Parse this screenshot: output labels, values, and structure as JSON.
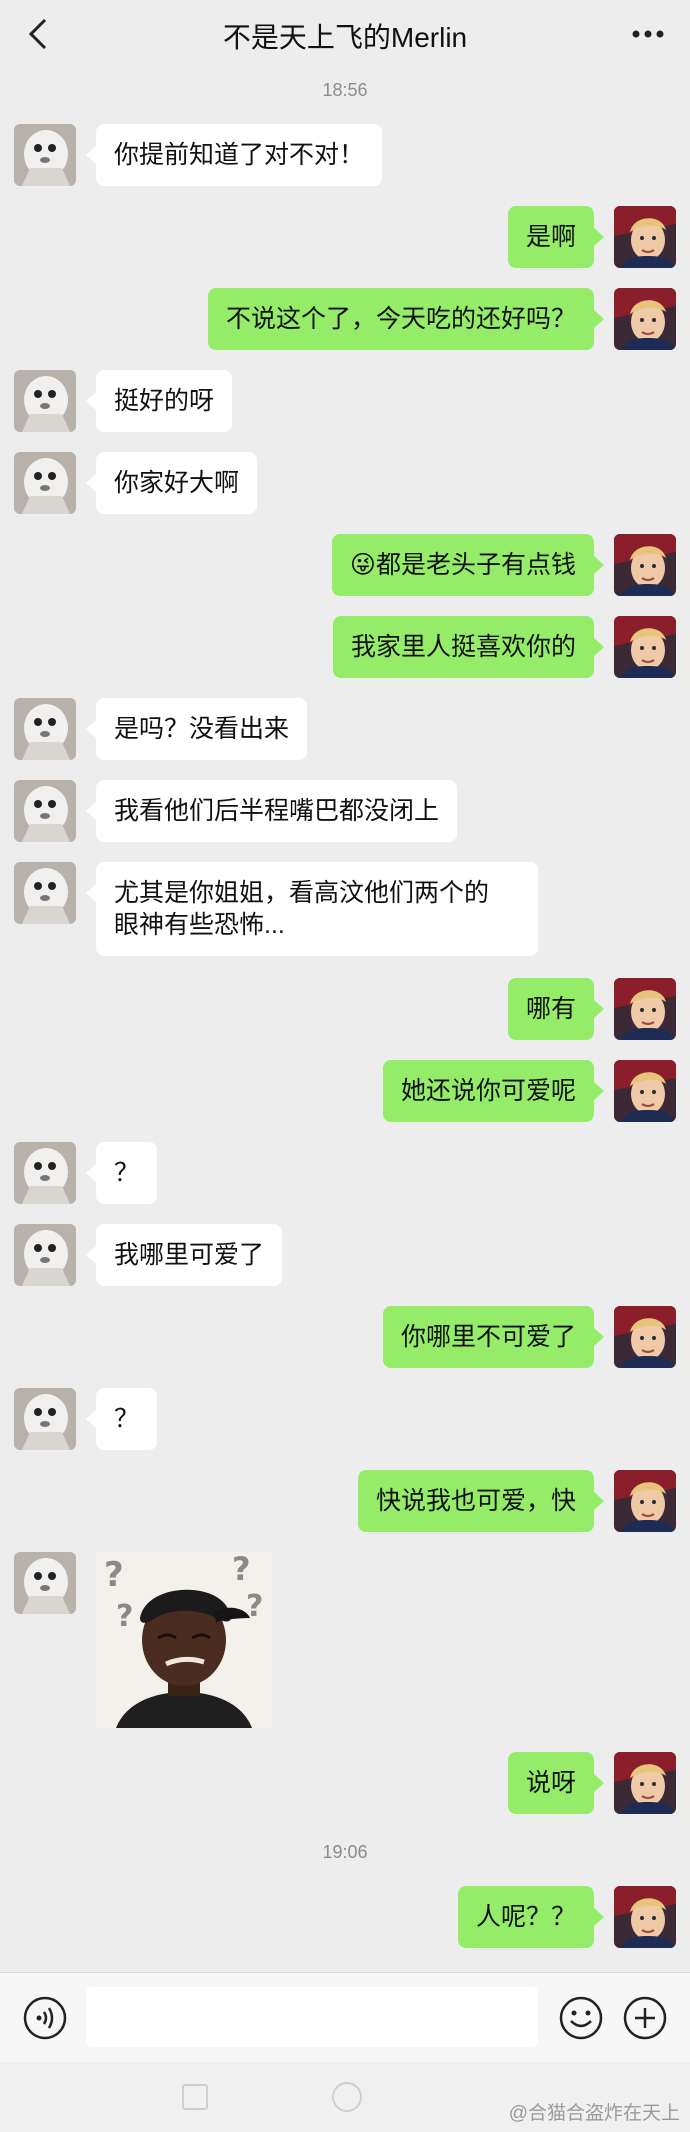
{
  "header": {
    "title": "不是天上飞的Merlin"
  },
  "timestamps": [
    "18:56",
    "19:06"
  ],
  "messages": [
    {
      "side": "left",
      "text": "你提前知道了对不对！"
    },
    {
      "side": "right",
      "text": "是啊"
    },
    {
      "side": "right",
      "text": "不说这个了，今天吃的还好吗？"
    },
    {
      "side": "left",
      "text": "挺好的呀"
    },
    {
      "side": "left",
      "text": "你家好大啊"
    },
    {
      "side": "right",
      "emoji": "😜",
      "text": "都是老头子有点钱"
    },
    {
      "side": "right",
      "text": "我家里人挺喜欢你的"
    },
    {
      "side": "left",
      "text": "是吗？没看出来"
    },
    {
      "side": "left",
      "text": "我看他们后半程嘴巴都没闭上"
    },
    {
      "side": "left",
      "line1": "尤其是你姐姐，看高汶他们两个的",
      "line2": "眼神有些恐怖..."
    },
    {
      "side": "right",
      "text": "哪有"
    },
    {
      "side": "right",
      "text": "她还说你可爱呢"
    },
    {
      "side": "left",
      "text": "？"
    },
    {
      "side": "left",
      "text": "我哪里可爱了"
    },
    {
      "side": "right",
      "text": "你哪里不可爱了"
    },
    {
      "side": "left",
      "text": "？"
    },
    {
      "side": "right",
      "text": "快说我也可爱，快"
    },
    {
      "side": "left",
      "sticker": "confused-man-sticker"
    },
    {
      "side": "right",
      "text": "说呀"
    },
    {
      "side": "right",
      "text": "人呢？？"
    }
  ],
  "input": {
    "value": "",
    "placeholder": ""
  },
  "icons": {
    "back": "chevron-left-icon",
    "more": "more-horizontal-icon",
    "voice": "voice-icon",
    "emoji": "emoji-icon",
    "plus": "plus-icon"
  },
  "footer": {
    "watermark": "@合猫合盗炸在天上"
  },
  "colors": {
    "background": "#ededed",
    "self_bubble": "#95ec69",
    "other_bubble": "#ffffff"
  }
}
